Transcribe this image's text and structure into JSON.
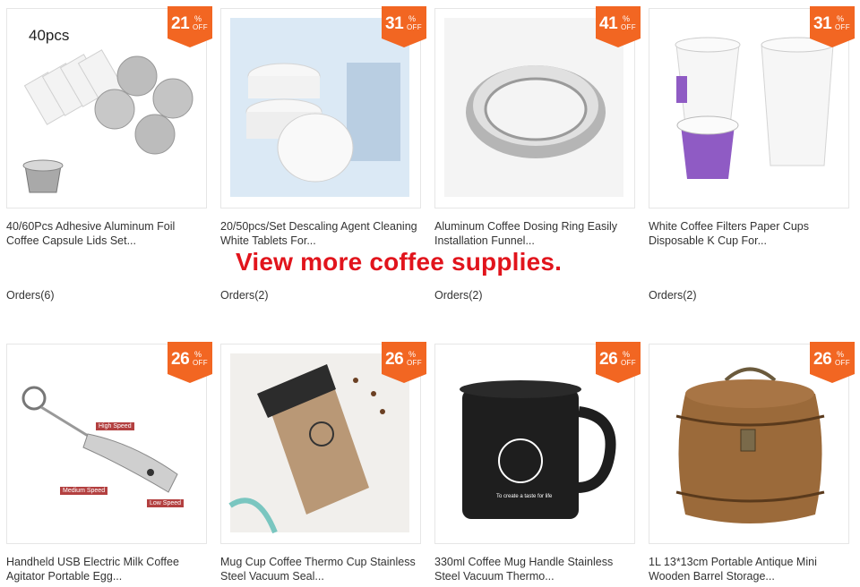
{
  "cta": "View more coffee supplies.",
  "accent": "#f26622",
  "cta_color": "#e1141c",
  "products": [
    {
      "discount": "21",
      "pct": "%",
      "off": "OFF",
      "image_text": "40pcs",
      "title": "40/60Pcs Adhesive Aluminum Foil Coffee Capsule Lids Set...",
      "orders": "Orders(6)"
    },
    {
      "discount": "31",
      "pct": "%",
      "off": "OFF",
      "title": "20/50pcs/Set Descaling Agent Cleaning White Tablets For...",
      "orders": "Orders(2)"
    },
    {
      "discount": "41",
      "pct": "%",
      "off": "OFF",
      "title": "Aluminum Coffee Dosing Ring Easily Installation Funnel...",
      "orders": "Orders(2)"
    },
    {
      "discount": "31",
      "pct": "%",
      "off": "OFF",
      "title": "White Coffee Filters Paper Cups Disposable K Cup For...",
      "orders": "Orders(2)"
    },
    {
      "discount": "26",
      "pct": "%",
      "off": "OFF",
      "image_labels": [
        "High Speed",
        "Medium Speed",
        "Low Speed"
      ],
      "title": "Handheld USB Electric Milk Coffee Agitator Portable Egg...",
      "orders": ""
    },
    {
      "discount": "26",
      "pct": "%",
      "off": "OFF",
      "title": "Mug Cup Coffee Thermo Cup Stainless Steel Vacuum Seal...",
      "orders": ""
    },
    {
      "discount": "26",
      "pct": "%",
      "off": "OFF",
      "image_text": "To create a taste for life",
      "title": "330ml Coffee Mug Handle Stainless Steel Vacuum Thermo...",
      "orders": ""
    },
    {
      "discount": "26",
      "pct": "%",
      "off": "OFF",
      "title": "1L 13*13cm Portable Antique Mini Wooden Barrel Storage...",
      "orders": ""
    }
  ]
}
